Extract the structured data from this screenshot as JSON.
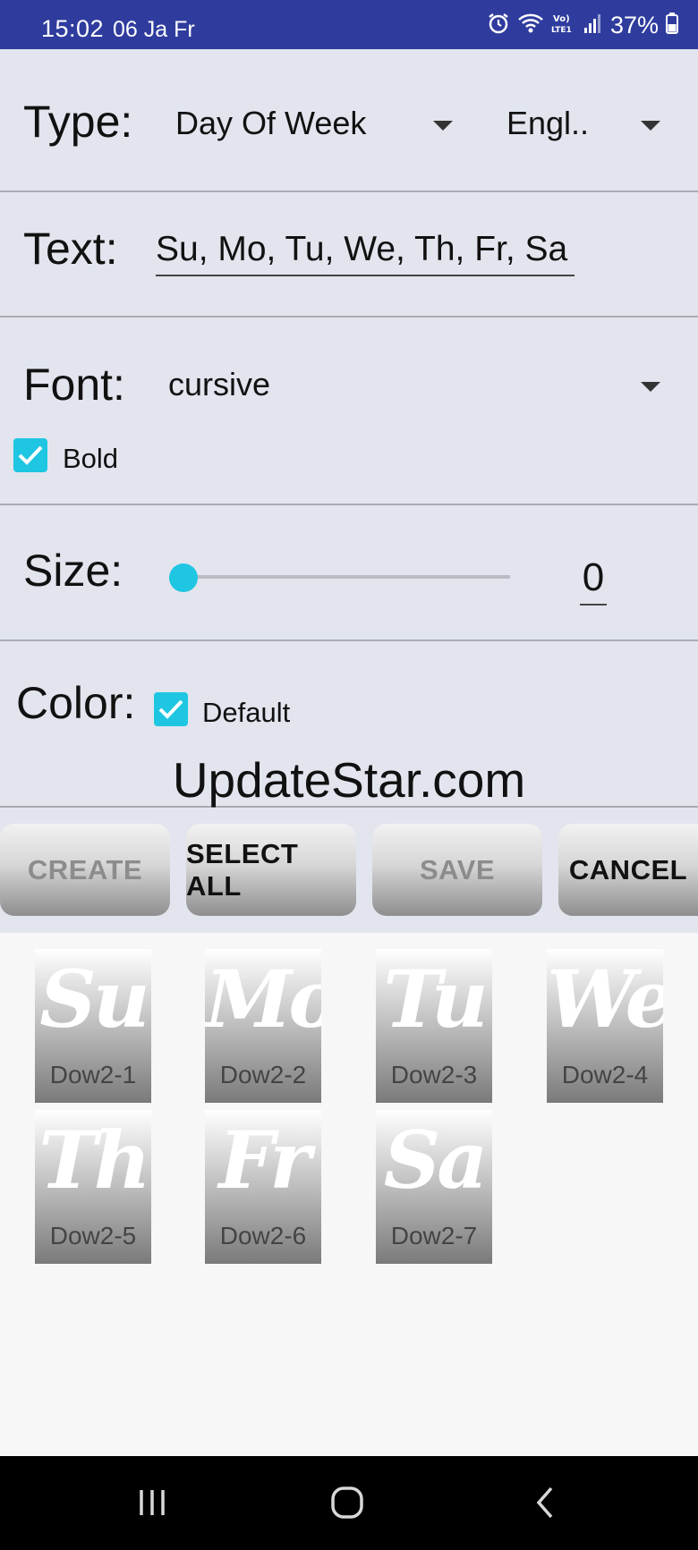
{
  "status_bar": {
    "time": "15:02",
    "date": "06 Ja Fr",
    "battery": "37%",
    "icons": [
      "alarm-icon",
      "wifi-icon",
      "volte-icon",
      "signal-icon",
      "battery-icon"
    ]
  },
  "form": {
    "type_label": "Type:",
    "type_value": "Day Of Week",
    "language_value": "Engl..",
    "text_label": "Text:",
    "text_value": "Su, Mo, Tu, We, Th, Fr, Sa",
    "font_label": "Font:",
    "font_value": "cursive",
    "bold_label": "Bold",
    "bold_checked": true,
    "size_label": "Size:",
    "size_value": "0",
    "size_fraction": 0.0,
    "color_label": "Color:",
    "default_label": "Default",
    "default_checked": true
  },
  "watermark": "UpdateStar.com",
  "buttons": [
    {
      "label": "CREATE",
      "enabled": false
    },
    {
      "label": "SELECT ALL",
      "enabled": true
    },
    {
      "label": "SAVE",
      "enabled": false
    },
    {
      "label": "CANCEL",
      "enabled": true
    }
  ],
  "tiles": [
    {
      "glyph": "Su",
      "caption": "Dow2-1"
    },
    {
      "glyph": "Mo",
      "caption": "Dow2-2"
    },
    {
      "glyph": "Tu",
      "caption": "Dow2-3"
    },
    {
      "glyph": "We",
      "caption": "Dow2-4"
    },
    {
      "glyph": "Th",
      "caption": "Dow2-5"
    },
    {
      "glyph": "Fr",
      "caption": "Dow2-6"
    },
    {
      "glyph": "Sa",
      "caption": "Dow2-7"
    }
  ],
  "colors": {
    "status_bar": "#2f3c9e",
    "accent": "#1ec6e2",
    "panel": "#e2e5ee"
  },
  "nav_bar": {
    "icons": [
      "recent-apps-icon",
      "home-icon",
      "back-icon"
    ]
  }
}
